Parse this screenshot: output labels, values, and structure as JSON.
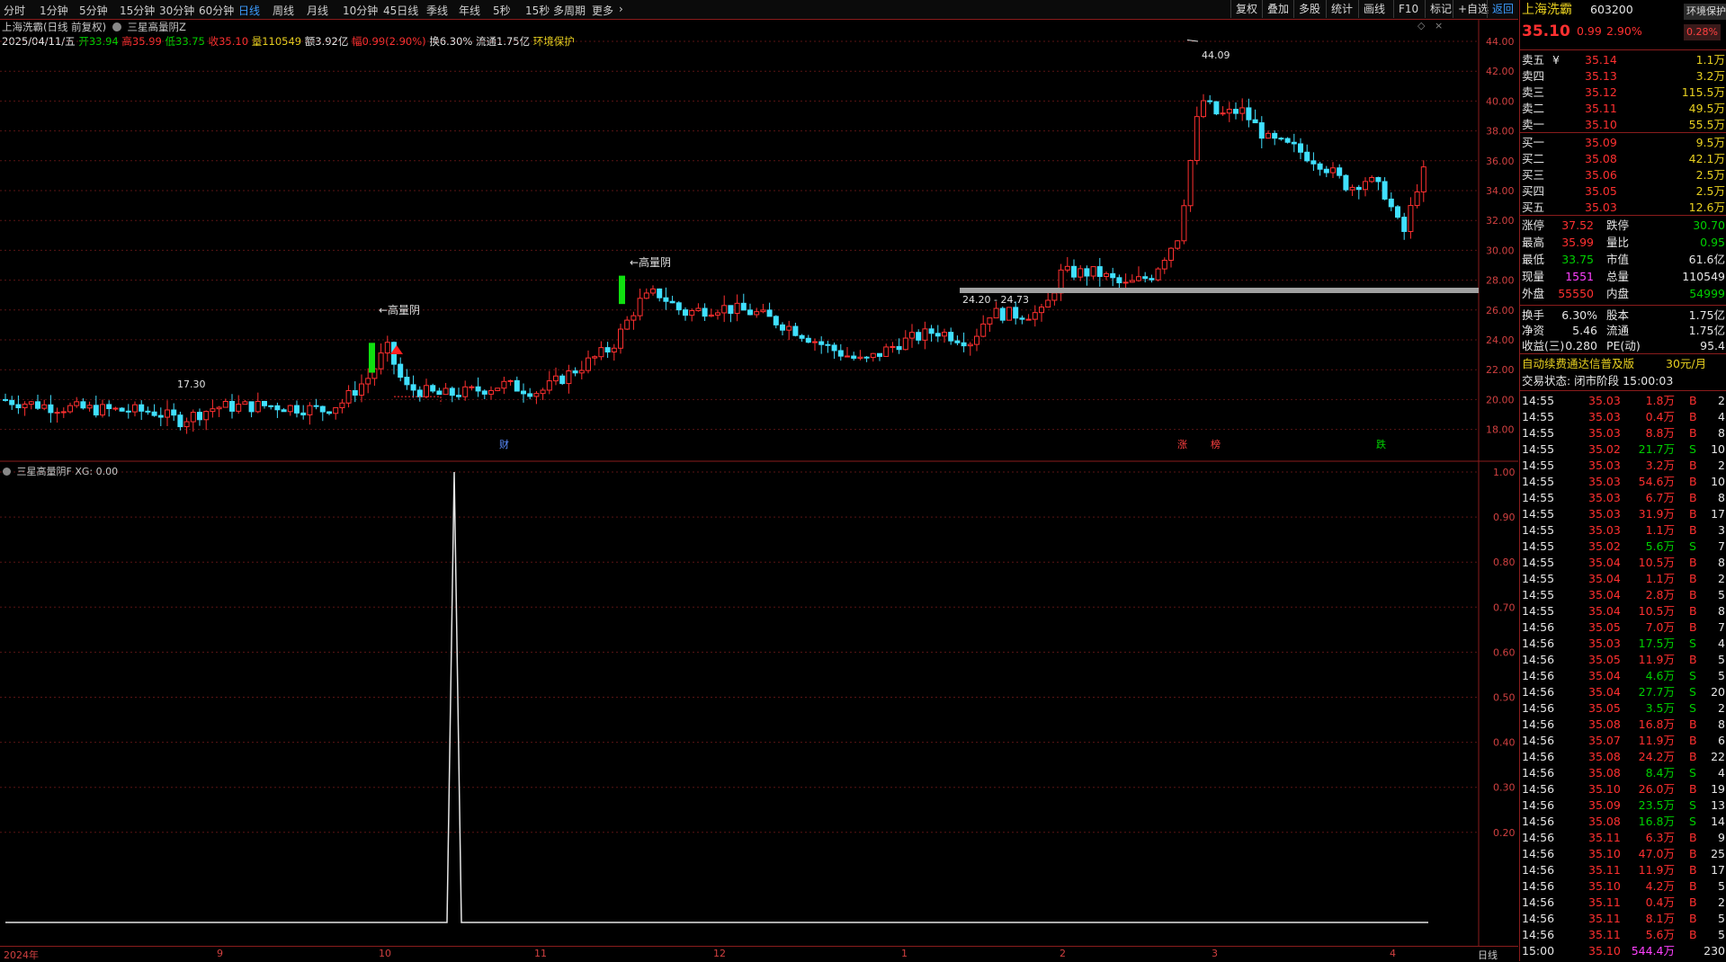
{
  "toolbar": {
    "periods": [
      "分时",
      "1分钟",
      "5分钟",
      "15分钟",
      "30分钟",
      "60分钟",
      "日线",
      "周线",
      "月线",
      "10分钟",
      "45日线",
      "季线",
      "年线",
      "5秒",
      "15秒",
      "多周期",
      "更多"
    ],
    "active_period": "日线",
    "right_buttons": [
      "复权",
      "叠加",
      "多股",
      "统计",
      "画线",
      "F10",
      "标记",
      "+自选",
      "返回"
    ]
  },
  "main_header": {
    "title": "上海洗霸(日线 前复权)",
    "formula": "三星高量阴Z",
    "date": "2025/04/11/五",
    "open_label": "开",
    "open": "33.94",
    "high_label": "高",
    "high": "35.99",
    "low_label": "低",
    "low": "33.75",
    "close_label": "收",
    "close": "35.10",
    "vol_label": "量",
    "vol": "110549",
    "amount_label": "额",
    "amount": "3.92亿",
    "chg_label": "幅",
    "chg": "0.99(2.90%)",
    "turnover_label": "换",
    "turnover": "6.30%",
    "float_label": "流通",
    "float": "1.75亿",
    "env": "环境保护"
  },
  "main_chart": {
    "y_ticks": [
      "44.00",
      "42.00",
      "40.00",
      "38.00",
      "36.00",
      "34.00",
      "32.00",
      "30.00",
      "28.00",
      "26.00",
      "24.00",
      "22.00",
      "20.00",
      "18.00"
    ],
    "annotations": {
      "high_point": "44.09",
      "low_point": "17.30",
      "signal_1": "←高量阴",
      "signal_2": "←高量阴",
      "range": "24.20 - 24.73",
      "mark_cai": "财",
      "mark_zhang": "涨",
      "mark_bang": "榜",
      "mark_die": "跌"
    }
  },
  "chart_data": {
    "type": "candlestick",
    "ylim": [
      17.3,
      44.09
    ],
    "highest": 44.09,
    "lowest": 17.3,
    "last": {
      "date": "2025/04/11",
      "open": 33.94,
      "high": 35.99,
      "low": 33.75,
      "close": 35.1
    },
    "support_band": [
      24.2,
      24.73
    ],
    "indicator": {
      "name": "三星高量阴F",
      "series": "XG",
      "value": 0.0,
      "y_ticks": [
        "1.00",
        "0.90",
        "0.80",
        "0.70",
        "0.60",
        "0.50",
        "0.40",
        "0.30",
        "0.20"
      ],
      "signal_at_month": "10",
      "signal_value": 1.0
    }
  },
  "indicator_header": {
    "name": "三星高量阴F",
    "series": "XG:",
    "value": "0.00"
  },
  "x_axis": {
    "labels": [
      "2024年",
      "9",
      "10",
      "11",
      "12",
      "1",
      "2",
      "3",
      "4"
    ],
    "right_label": "日线"
  },
  "panel": {
    "stock_name": "上海洗霸",
    "stock_code": "603200",
    "env_button": "环境保护",
    "price": "35.10",
    "change": "0.99",
    "change_pct": "2.90%",
    "tag_pct": "0.28%",
    "asks": [
      {
        "label": "卖五",
        "mark": "¥",
        "price": "35.14",
        "vol": "1.1万"
      },
      {
        "label": "卖四",
        "mark": "",
        "price": "35.13",
        "vol": "3.2万"
      },
      {
        "label": "卖三",
        "mark": "",
        "price": "35.12",
        "vol": "115.5万"
      },
      {
        "label": "卖二",
        "mark": "",
        "price": "35.11",
        "vol": "49.5万"
      },
      {
        "label": "卖一",
        "mark": "",
        "price": "35.10",
        "vol": "55.5万"
      }
    ],
    "bids": [
      {
        "label": "买一",
        "price": "35.09",
        "vol": "9.5万"
      },
      {
        "label": "买二",
        "price": "35.08",
        "vol": "42.1万"
      },
      {
        "label": "买三",
        "price": "35.06",
        "vol": "2.5万"
      },
      {
        "label": "买四",
        "price": "35.05",
        "vol": "2.5万"
      },
      {
        "label": "买五",
        "price": "35.03",
        "vol": "12.6万"
      }
    ],
    "stats": [
      {
        "l1": "涨停",
        "v1": "37.52",
        "c1": "red",
        "l2": "跌停",
        "v2": "30.70",
        "c2": "green"
      },
      {
        "l1": "最高",
        "v1": "35.99",
        "c1": "red",
        "l2": "量比",
        "v2": "0.95",
        "c2": "green"
      },
      {
        "l1": "最低",
        "v1": "33.75",
        "c1": "green",
        "l2": "市值",
        "v2": "61.6亿",
        "c2": "white"
      },
      {
        "l1": "现量",
        "v1": "1551",
        "c1": "mag",
        "l2": "总量",
        "v2": "110549",
        "c2": "white"
      },
      {
        "l1": "外盘",
        "v1": "55550",
        "c1": "red",
        "l2": "内盘",
        "v2": "54999",
        "c2": "green"
      }
    ],
    "stats2": [
      {
        "l1": "换手",
        "v1": "6.30%",
        "l2": "股本",
        "v2": "1.75亿"
      },
      {
        "l1": "净资",
        "v1": "5.46",
        "l2": "流通",
        "v2": "1.75亿"
      },
      {
        "l1": "收益(三)",
        "v1": "0.280",
        "l2": "PE(动)",
        "v2": "95.4"
      }
    ],
    "promo": "自动续费通达信普及版",
    "promo_price": "30元/月",
    "trade_status": "交易状态: 闭市阶段 15:00:03",
    "ticks": [
      [
        "14:55",
        "35.03",
        "1.8万",
        "B",
        "2"
      ],
      [
        "14:55",
        "35.03",
        "0.4万",
        "B",
        "4"
      ],
      [
        "14:55",
        "35.03",
        "8.8万",
        "B",
        "8"
      ],
      [
        "14:55",
        "35.02",
        "21.7万",
        "S",
        "10"
      ],
      [
        "14:55",
        "35.03",
        "3.2万",
        "B",
        "2"
      ],
      [
        "14:55",
        "35.03",
        "54.6万",
        "B",
        "10"
      ],
      [
        "14:55",
        "35.03",
        "6.7万",
        "B",
        "8"
      ],
      [
        "14:55",
        "35.03",
        "31.9万",
        "B",
        "17"
      ],
      [
        "14:55",
        "35.03",
        "1.1万",
        "B",
        "3"
      ],
      [
        "14:55",
        "35.02",
        "5.6万",
        "S",
        "7"
      ],
      [
        "14:55",
        "35.04",
        "10.5万",
        "B",
        "8"
      ],
      [
        "14:55",
        "35.04",
        "1.1万",
        "B",
        "2"
      ],
      [
        "14:55",
        "35.04",
        "2.8万",
        "B",
        "5"
      ],
      [
        "14:55",
        "35.04",
        "10.5万",
        "B",
        "8"
      ],
      [
        "14:56",
        "35.05",
        "7.0万",
        "B",
        "7"
      ],
      [
        "14:56",
        "35.03",
        "17.5万",
        "S",
        "4"
      ],
      [
        "14:56",
        "35.05",
        "11.9万",
        "B",
        "5"
      ],
      [
        "14:56",
        "35.04",
        "4.6万",
        "S",
        "5"
      ],
      [
        "14:56",
        "35.04",
        "27.7万",
        "S",
        "20"
      ],
      [
        "14:56",
        "35.05",
        "3.5万",
        "S",
        "2"
      ],
      [
        "14:56",
        "35.08",
        "16.8万",
        "B",
        "8"
      ],
      [
        "14:56",
        "35.07",
        "11.9万",
        "B",
        "6"
      ],
      [
        "14:56",
        "35.08",
        "24.2万",
        "B",
        "22"
      ],
      [
        "14:56",
        "35.08",
        "8.4万",
        "S",
        "4"
      ],
      [
        "14:56",
        "35.10",
        "26.0万",
        "B",
        "19"
      ],
      [
        "14:56",
        "35.09",
        "23.5万",
        "S",
        "13"
      ],
      [
        "14:56",
        "35.08",
        "16.8万",
        "S",
        "14"
      ],
      [
        "14:56",
        "35.11",
        "6.3万",
        "B",
        "9"
      ],
      [
        "14:56",
        "35.10",
        "47.0万",
        "B",
        "25"
      ],
      [
        "14:56",
        "35.11",
        "11.9万",
        "B",
        "17"
      ],
      [
        "14:56",
        "35.10",
        "4.2万",
        "B",
        "5"
      ],
      [
        "14:56",
        "35.11",
        "0.4万",
        "B",
        "2"
      ],
      [
        "14:56",
        "35.11",
        "8.1万",
        "B",
        "5"
      ],
      [
        "14:56",
        "35.11",
        "5.6万",
        "B",
        "5"
      ],
      [
        "15:00",
        "35.10",
        "544.4万",
        "",
        "230"
      ]
    ]
  }
}
